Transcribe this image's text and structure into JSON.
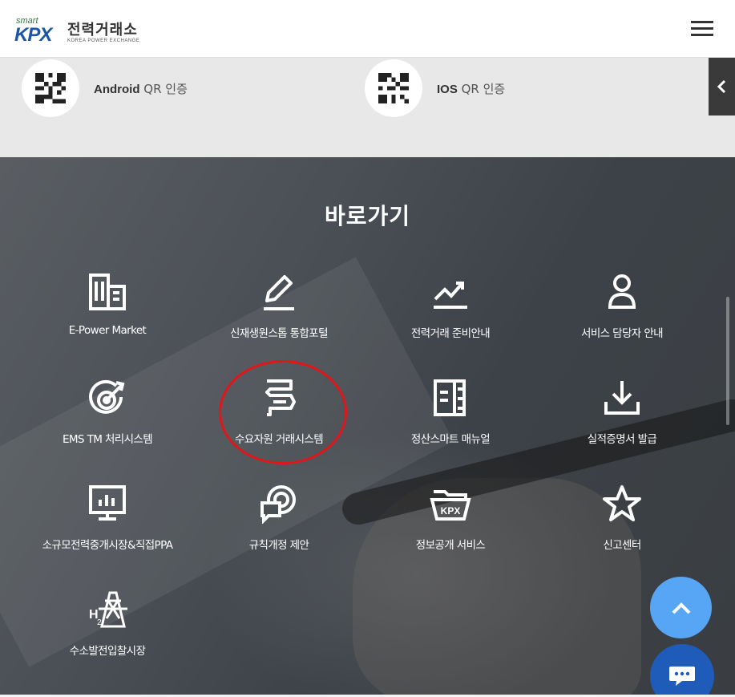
{
  "header": {
    "logo_smart": "smart",
    "logo_kpx": "KPX",
    "logo_ko": "전력거래소",
    "logo_en": "KOREA POWER EXCHANGE",
    "menu_icon": "hamburger-icon"
  },
  "qr": {
    "android": {
      "bold": "Android",
      "rest": "QR 인증"
    },
    "ios": {
      "bold": "IOS",
      "rest": "QR 인증"
    },
    "side_tab_icon": "chevron-left-icon"
  },
  "shortcuts": {
    "title": "바로가기",
    "items": [
      {
        "label": "E-Power Market",
        "icon": "building-icon"
      },
      {
        "label": "신재생원스톱 통합포털",
        "icon": "pencil-icon"
      },
      {
        "label": "전력거래 준비안내",
        "icon": "trend-chart-icon"
      },
      {
        "label": "서비스 담당자 안내",
        "icon": "person-icon"
      },
      {
        "label": "EMS TM 처리시스템",
        "icon": "target-icon"
      },
      {
        "label": "수요자원 거래시스템",
        "icon": "document-arrow-icon"
      },
      {
        "label": "정산스마트 매뉴얼",
        "icon": "manual-icon"
      },
      {
        "label": "실적증명서 발급",
        "icon": "download-icon"
      },
      {
        "label": "소규모전력중개시장&직접PPA",
        "icon": "presentation-chart-icon"
      },
      {
        "label": "규칙개정 제안",
        "icon": "speech-target-icon"
      },
      {
        "label": "정보공개 서비스",
        "icon": "kpx-folder-icon"
      },
      {
        "label": "신고센터",
        "icon": "star-icon"
      },
      {
        "label": "수소발전입찰시장",
        "icon": "hydrogen-tower-icon"
      }
    ]
  },
  "floating": {
    "top_icon": "chevron-up-icon",
    "chat_icon": "chat-icon"
  },
  "colors": {
    "brand_blue": "#1c55a7",
    "top_button": "#56a6f5",
    "chat_button": "#1f5bb8",
    "highlight": "#e0161b"
  }
}
